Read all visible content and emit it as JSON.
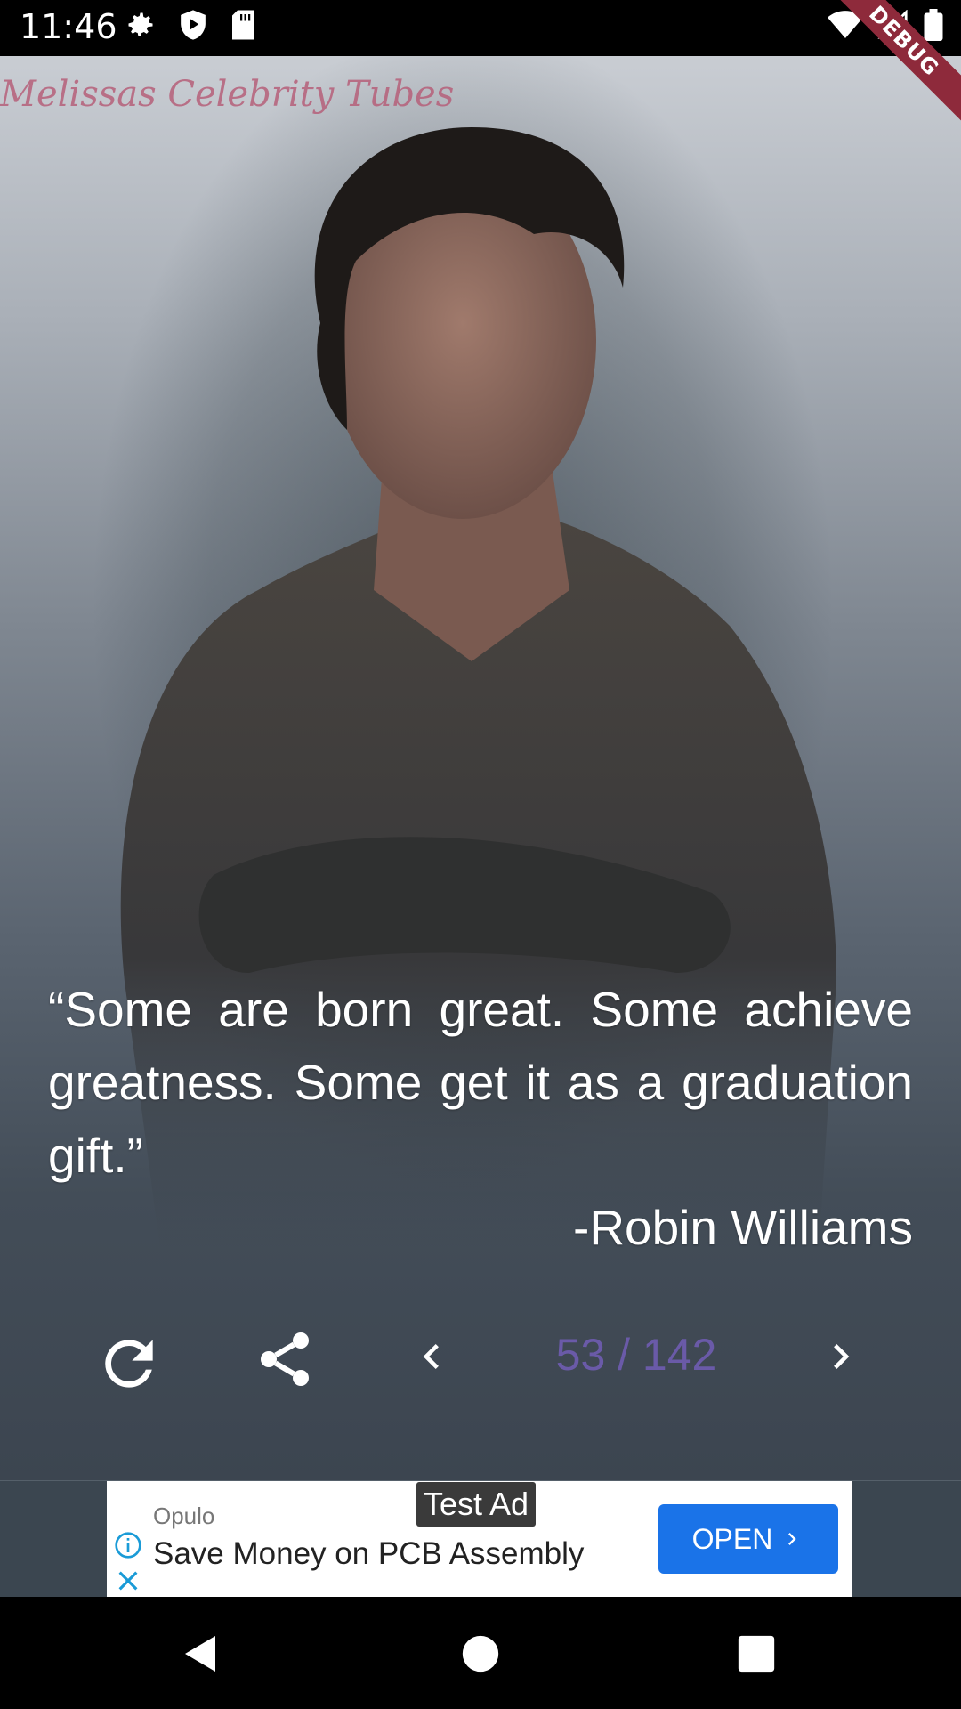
{
  "status_bar": {
    "time": "11:46",
    "left_icons": [
      "gear-icon",
      "shield-play-icon",
      "sd-card-icon"
    ],
    "right_icons": [
      "wifi-icon",
      "signal-icon",
      "battery-icon"
    ],
    "debug_label": "DEBUG"
  },
  "watermark": "Melissas Celebrity Tubes",
  "quote": {
    "text": "“Some are born great. Some achieve greatness. Some get it as a graduation gift.”",
    "author": "-Robin Williams"
  },
  "controls": {
    "refresh_icon": "refresh-icon",
    "share_icon": "share-icon",
    "prev_icon": "chevron-left-icon",
    "page_counter": "53 / 142",
    "next_icon": "chevron-right-icon"
  },
  "ad": {
    "test_label": "Test Ad",
    "advertiser": "Opulo",
    "headline": "Save Money on PCB Assembly",
    "open_label": "OPEN",
    "button_color": "#1a73e8"
  },
  "colors": {
    "page_counter": "#6a5aa8",
    "debug_ribbon": "#8e2a3b"
  },
  "nav_bar": {
    "icons": [
      "back-icon",
      "home-icon",
      "recents-icon"
    ]
  }
}
